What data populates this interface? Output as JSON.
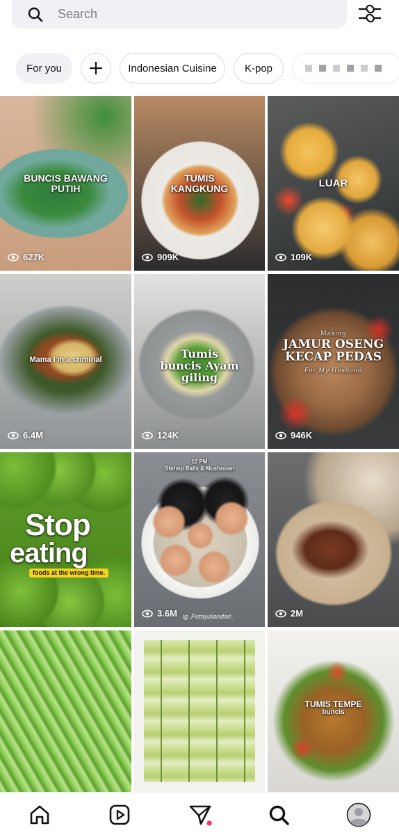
{
  "search": {
    "placeholder": "Search"
  },
  "chips": {
    "for_you": "For you",
    "indonesian": "Indonesian Cuisine",
    "kpop": "K-pop"
  },
  "tiles": [
    {
      "caption": "BUNCIS BAWANG PUTIH",
      "views": "627K"
    },
    {
      "caption": "TUMIS KANGKUNG",
      "views": "909K"
    },
    {
      "caption": "LUAR",
      "views": "109K"
    },
    {
      "caption": "Mama I'm a criminal",
      "views": "6.4M"
    },
    {
      "caption": "Tumis buncis Ayam giling",
      "views": "124K"
    },
    {
      "caption": "JAMUR OSENG KECAP PEDAS",
      "subtop": "Making",
      "sub": "For My Husband",
      "views": "946K"
    },
    {
      "caption_a": "Stop",
      "caption_b": "eating",
      "sub": "foods at the wrong time.",
      "views": ""
    },
    {
      "caption_top": "12 PM",
      "caption": "Shrimp Balls & Mushroom",
      "watermark": "ig_Putriyuliandari_",
      "views": "3.6M"
    },
    {
      "caption": "",
      "views": "2M"
    },
    {
      "caption": "",
      "views": ""
    },
    {
      "caption": "",
      "views": ""
    },
    {
      "caption": "TUMIS TEMPE",
      "sub": "buncis",
      "views": ""
    }
  ],
  "colors": {
    "accent_dot": "#ff2d55",
    "chip_bg": "#eff1f4",
    "search_bg": "#eff1f4"
  },
  "nav": [
    "home-icon",
    "reels-icon",
    "messages-icon",
    "search-icon",
    "profile-icon"
  ]
}
